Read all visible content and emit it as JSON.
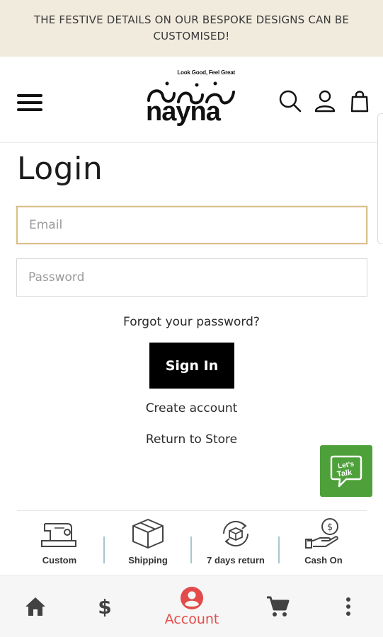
{
  "announcement": "THE FESTIVE DETAILS ON OUR BESPOKE DESIGNS CAN BE CUSTOMISED!",
  "brand": {
    "tagline": "Look Good, Feel Great",
    "wordmark": "nayna"
  },
  "page_title": "Login",
  "login_form": {
    "email_placeholder": "Email",
    "password_placeholder": "Password",
    "forgot_link": "Forgot your password?",
    "sign_in_label": "Sign In",
    "create_account_link": "Create account",
    "return_link": "Return to Store"
  },
  "chat_widget": {
    "label": "Let's Talk",
    "color": "#4ea03a"
  },
  "features": [
    {
      "icon": "sewing-machine-icon",
      "label": "Custom"
    },
    {
      "icon": "package-box-icon",
      "label": "Shipping"
    },
    {
      "icon": "return-box-icon",
      "label": "7 days return"
    },
    {
      "icon": "cash-hand-icon",
      "label": "Cash On"
    }
  ],
  "bottom_nav": {
    "items": [
      {
        "icon": "home-icon",
        "label": ""
      },
      {
        "icon": "dollar-icon",
        "label": ""
      },
      {
        "icon": "account-icon",
        "label": "Account",
        "active": true
      },
      {
        "icon": "cart-icon",
        "label": ""
      },
      {
        "icon": "more-vertical-icon",
        "label": ""
      }
    ],
    "active_color": "#e34b4b"
  },
  "colors": {
    "announcement_bg": "#f1ebde",
    "focus_border": "#d9c08b",
    "button_bg": "#000000"
  }
}
